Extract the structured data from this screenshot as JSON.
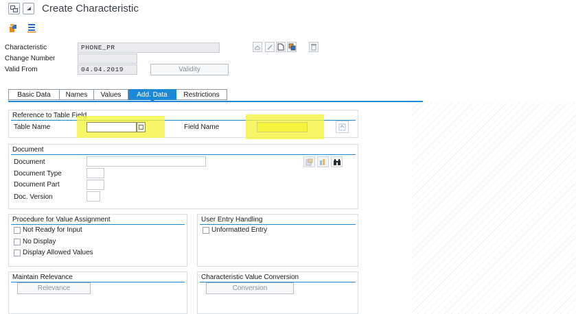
{
  "window": {
    "title": "Create Characteristic"
  },
  "toolbar": {
    "items": [
      "class-icon",
      "list-icon"
    ]
  },
  "header": {
    "characteristic_label": "Characteristic",
    "characteristic_value": "PHONE_PR",
    "change_number_label": "Change Number",
    "change_number_value": "",
    "valid_from_label": "Valid From",
    "valid_from_value": "04.04.2019",
    "validity_button": "Validity"
  },
  "tabs": [
    {
      "label": "Basic Data",
      "active": false
    },
    {
      "label": "Names",
      "active": false
    },
    {
      "label": "Values",
      "active": false
    },
    {
      "label": "Add. Data",
      "active": true
    },
    {
      "label": "Restrictions",
      "active": false
    }
  ],
  "reference": {
    "title": "Reference to Table Field",
    "table_name_label": "Table Name",
    "table_name_value": "",
    "field_name_label": "Field Name",
    "field_name_value": ""
  },
  "document": {
    "title": "Document",
    "document_label": "Document",
    "document_type_label": "Document Type",
    "document_part_label": "Document Part",
    "doc_version_label": "Doc. Version"
  },
  "procedure": {
    "title": "Procedure for Value Assignment",
    "options": [
      "Not Ready for Input",
      "No Display",
      "Display Allowed Values"
    ]
  },
  "user_entry": {
    "title": "User Entry Handling",
    "options": [
      "Unformatted Entry"
    ]
  },
  "relevance": {
    "title": "Maintain Relevance",
    "button": "Relevance"
  },
  "conversion": {
    "title": "Characteristic Value Conversion",
    "button": "Conversion"
  },
  "colors": {
    "accent": "#1e88d8",
    "highlight": "#f5f33b",
    "field_bg": "#e9ebee"
  }
}
